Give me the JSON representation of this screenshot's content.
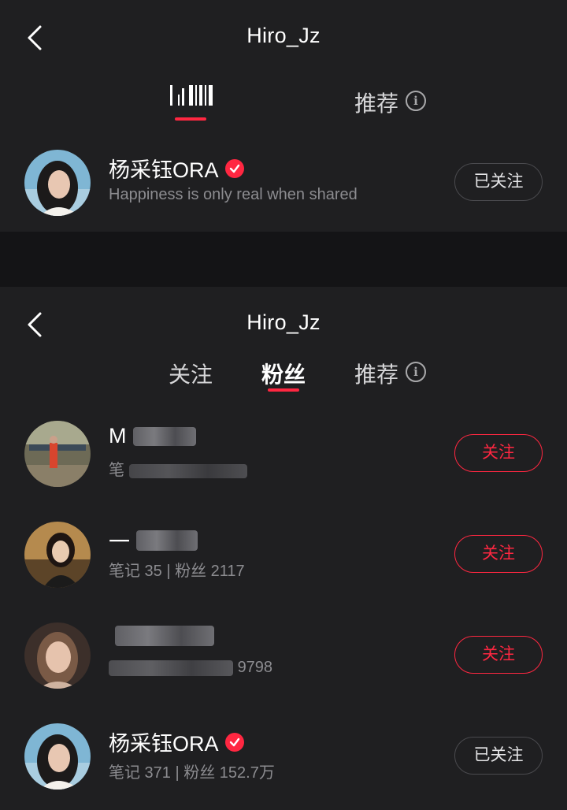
{
  "colors": {
    "accent": "#ff2741",
    "panel_bg": "#1f1f21",
    "page_bg": "#141416",
    "secondary_text": "#8c8c90"
  },
  "top_screen": {
    "title": "Hiro_Jz",
    "back_icon": "chevron-left-icon",
    "tabs": [
      {
        "label": "",
        "active": true,
        "note": "label is glitched/unreadable in original"
      },
      {
        "label": "推荐",
        "active": false,
        "icon": "info-icon"
      }
    ],
    "user": {
      "name": "杨采钰ORA",
      "verified": true,
      "bio": "Happiness is only real when shared",
      "button": "已关注"
    }
  },
  "bottom_screen": {
    "title": "Hiro_Jz",
    "back_icon": "chevron-left-icon",
    "tabs": [
      {
        "label": "关注",
        "active": false
      },
      {
        "label": "粉丝",
        "active": true
      },
      {
        "label": "推荐",
        "active": false,
        "icon": "info-icon"
      }
    ],
    "list": [
      {
        "name_visible": "M",
        "stats_visible": "笔",
        "button": "关注"
      },
      {
        "name_visible": "一",
        "stats": "笔记 35 | 粉丝 2117",
        "button": "关注"
      },
      {
        "name_visible": "",
        "stats_visible": "9798",
        "button": "关注"
      },
      {
        "name": "杨采钰ORA",
        "verified": true,
        "stats": "笔记 371 | 粉丝 152.7万",
        "button": "已关注"
      }
    ]
  }
}
